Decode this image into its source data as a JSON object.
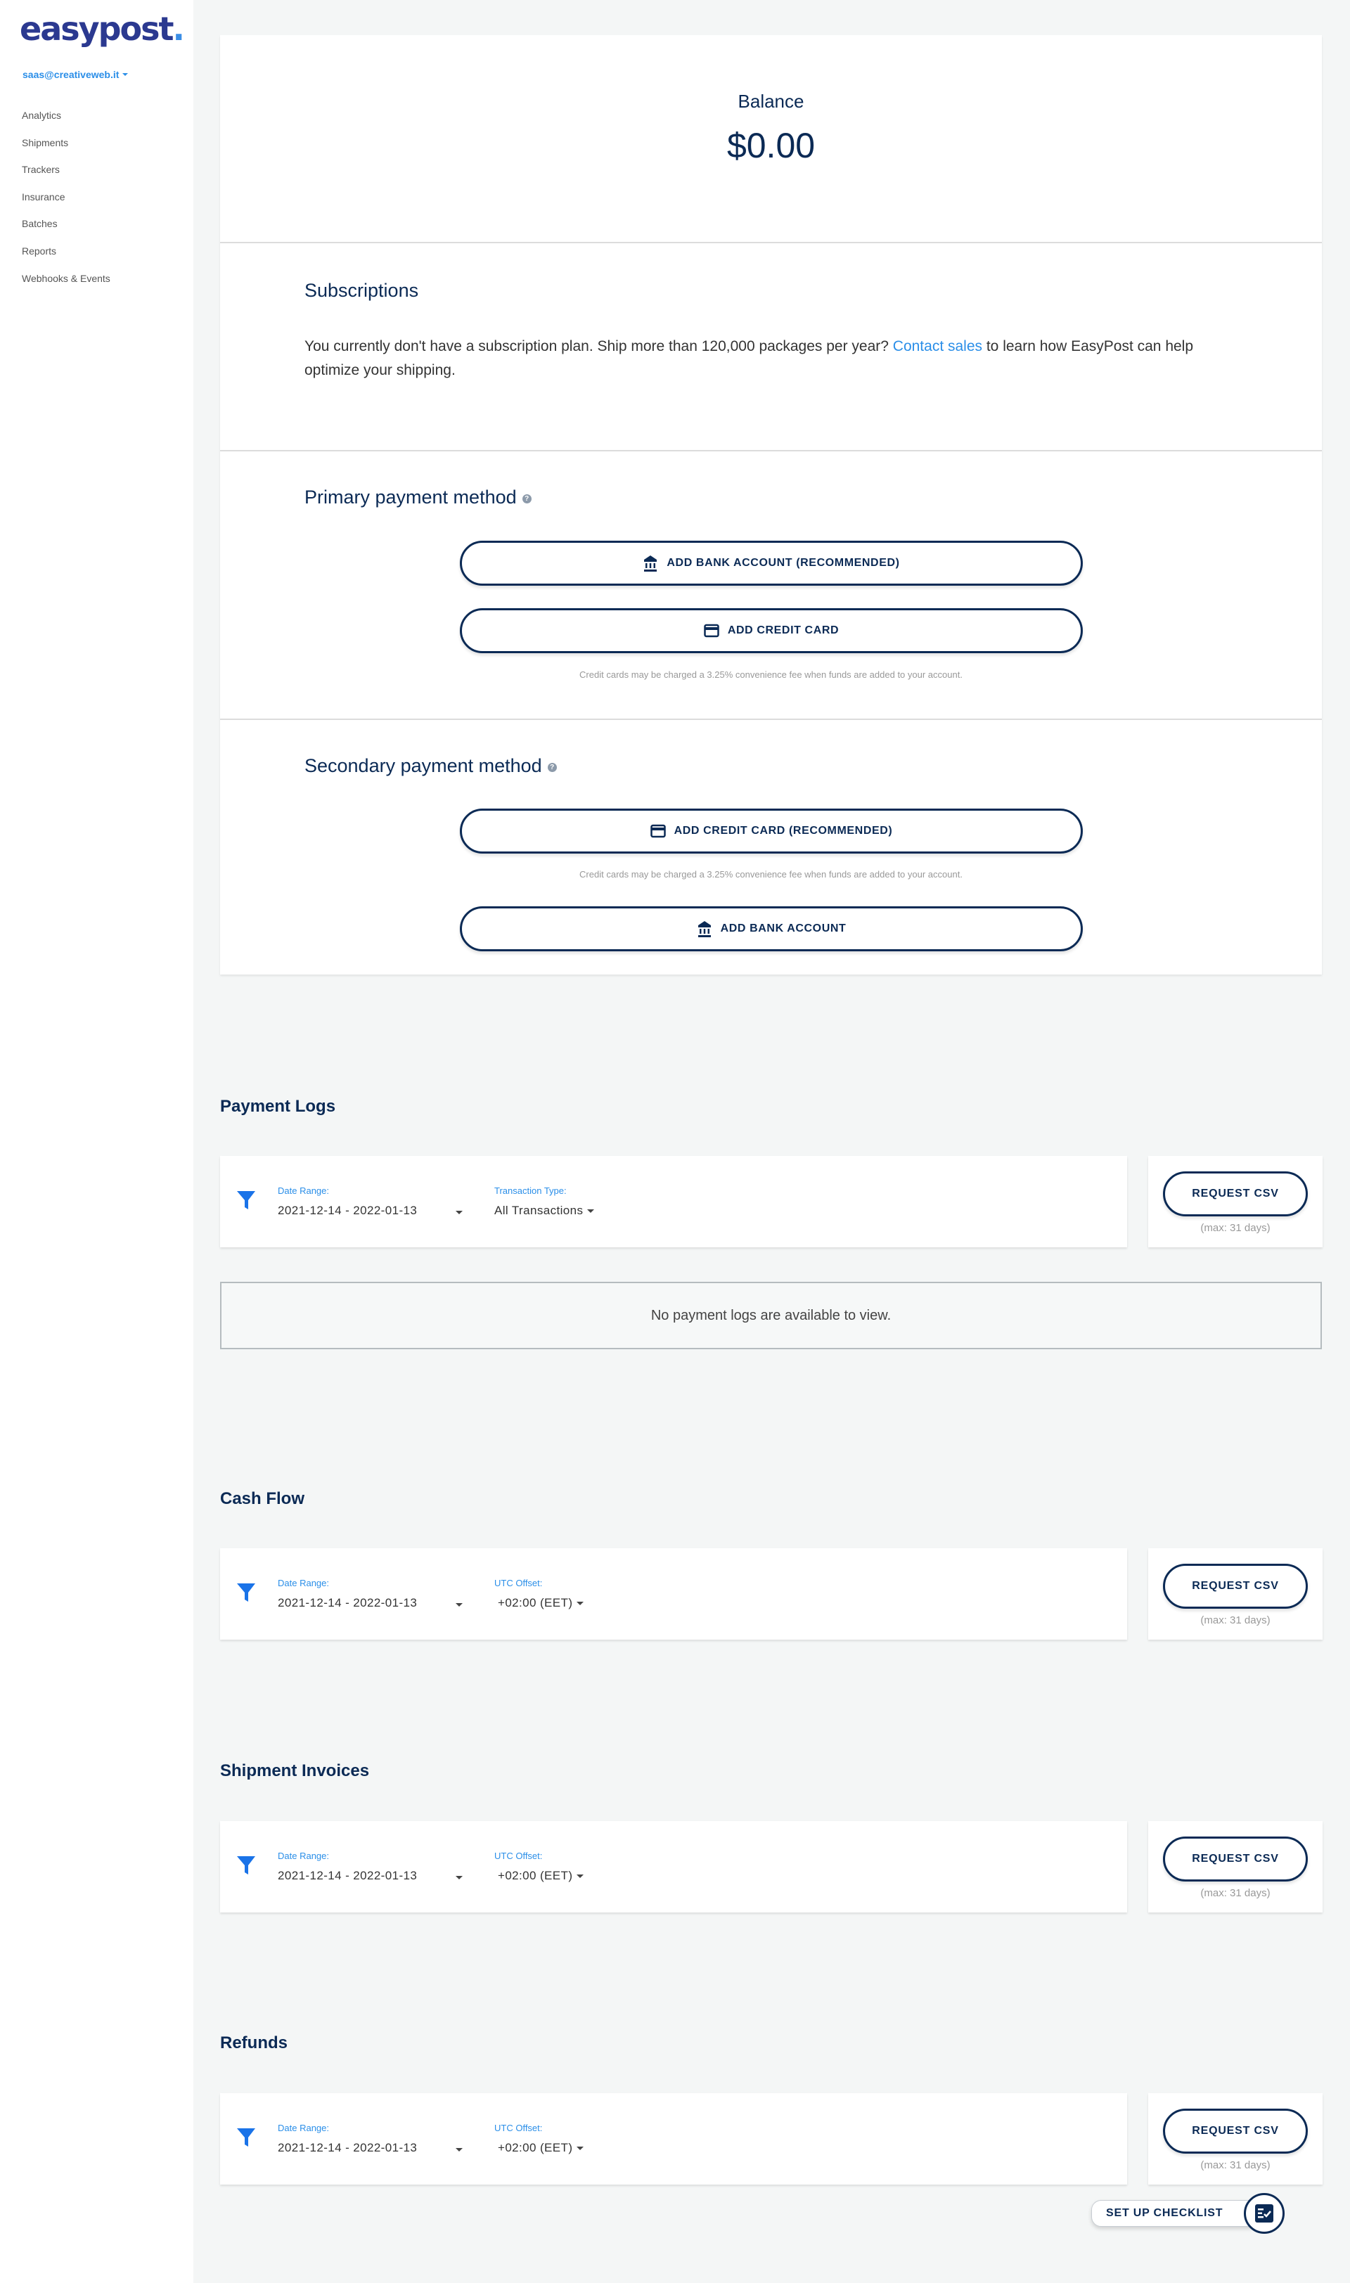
{
  "sidebar": {
    "logo_text": "easypost",
    "logo_dot": ".",
    "account_email": "saas@creativeweb.it",
    "nav": [
      {
        "label": "Analytics"
      },
      {
        "label": "Shipments"
      },
      {
        "label": "Trackers"
      },
      {
        "label": "Insurance"
      },
      {
        "label": "Batches"
      },
      {
        "label": "Reports"
      },
      {
        "label": "Webhooks & Events"
      }
    ]
  },
  "balance": {
    "label": "Balance",
    "value": "$0.00"
  },
  "subscriptions": {
    "title": "Subscriptions",
    "text_before": "You currently don't have a subscription plan. Ship more than 120,000 packages per year? ",
    "link": "Contact sales",
    "text_after": " to learn how EasyPost can help optimize your shipping."
  },
  "primary_payment": {
    "title": "Primary payment method",
    "help": "?",
    "buttons": [
      {
        "label": "ADD BANK ACCOUNT (RECOMMENDED)",
        "icon": "bank-icon"
      },
      {
        "label": "ADD CREDIT CARD",
        "icon": "credit-card-icon"
      }
    ],
    "note": "Credit cards may be charged a 3.25% convenience fee when funds are added to your account."
  },
  "secondary_payment": {
    "title": "Secondary payment method",
    "help": "?",
    "buttons": [
      {
        "label": "ADD CREDIT CARD (RECOMMENDED)",
        "icon": "credit-card-icon"
      },
      {
        "label": "ADD BANK ACCOUNT",
        "icon": "bank-icon"
      }
    ],
    "note": "Credit cards may be charged a 3.25% convenience fee when funds are added to your account."
  },
  "reports": [
    {
      "title": "Payment Logs",
      "date_label": "Date Range:",
      "date_value": "2021-12-14 - 2022-01-13",
      "second_label": "Transaction Type:",
      "second_value": "All Transactions",
      "csv_button": "REQUEST CSV",
      "csv_note": "(max: 31 days)",
      "empty_message": "No payment logs are available to view."
    },
    {
      "title": "Cash Flow",
      "date_label": "Date Range:",
      "date_value": "2021-12-14 - 2022-01-13",
      "second_label": "UTC Offset:",
      "second_value": "+02:00 (EET)",
      "csv_button": "REQUEST CSV",
      "csv_note": "(max: 31 days)"
    },
    {
      "title": "Shipment Invoices",
      "date_label": "Date Range:",
      "date_value": "2021-12-14 - 2022-01-13",
      "second_label": "UTC Offset:",
      "second_value": "+02:00 (EET)",
      "csv_button": "REQUEST CSV",
      "csv_note": "(max: 31 days)"
    },
    {
      "title": "Refunds",
      "date_label": "Date Range:",
      "date_value": "2021-12-14 - 2022-01-13",
      "second_label": "UTC Offset:",
      "second_value": "+02:00 (EET)",
      "csv_button": "REQUEST CSV",
      "csv_note": "(max: 31 days)"
    }
  ],
  "checklist": {
    "label": "SET UP CHECKLIST"
  },
  "colors": {
    "brand_navy": "#0b2a55",
    "logo_blue": "#2b3990",
    "link_blue": "#2a8ee8",
    "page_bg": "#f4f6f6"
  }
}
